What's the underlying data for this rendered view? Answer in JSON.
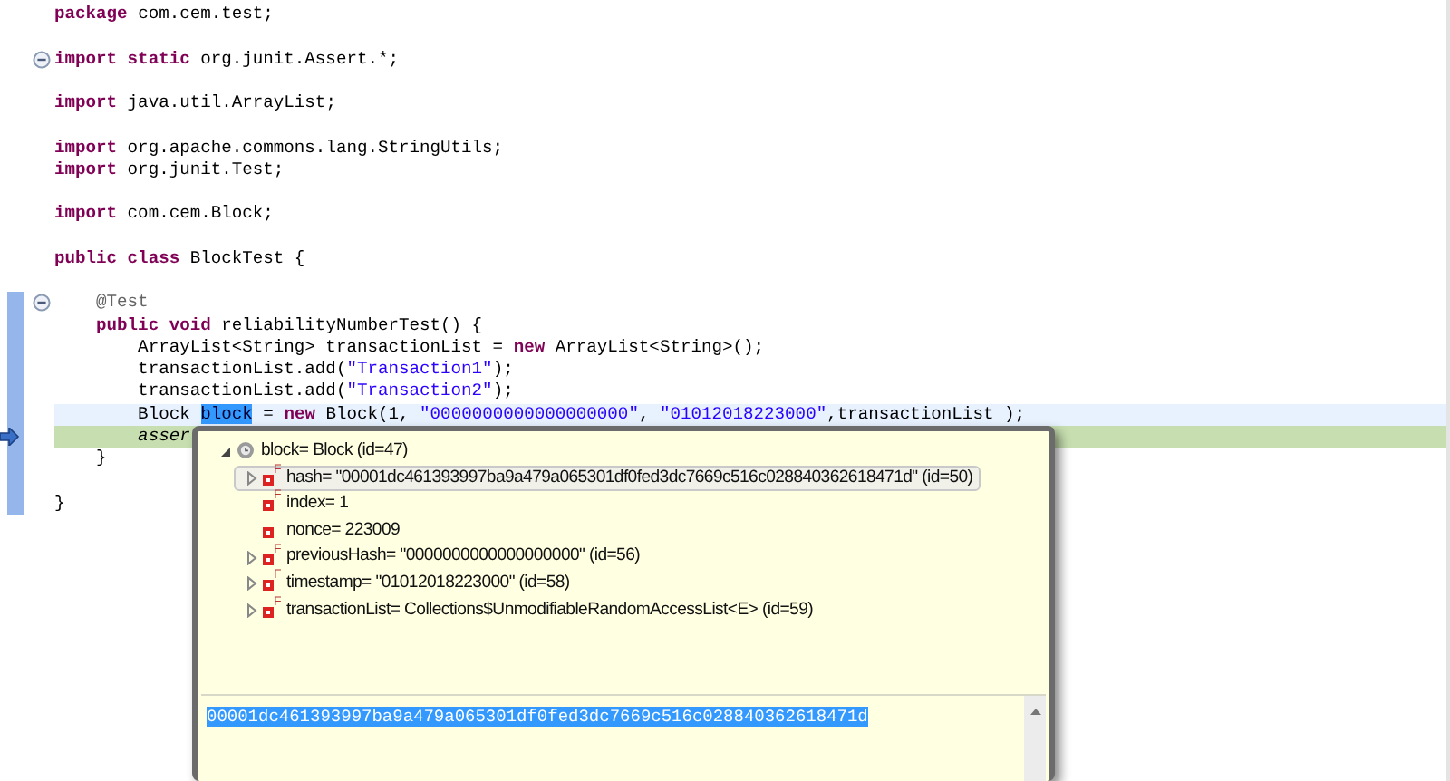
{
  "editor": {
    "lines": [
      {
        "kind": "code",
        "tokens": [
          {
            "kind": "keyword",
            "text": "package"
          },
          {
            "kind": "plain",
            "text": " com.cem.test;"
          }
        ]
      },
      {
        "kind": "blank"
      },
      {
        "kind": "code",
        "fold": true,
        "tokens": [
          {
            "kind": "keyword",
            "text": "import static"
          },
          {
            "kind": "plain",
            "text": " org.junit.Assert.*;"
          }
        ]
      },
      {
        "kind": "blank"
      },
      {
        "kind": "code",
        "tokens": [
          {
            "kind": "keyword",
            "text": "import"
          },
          {
            "kind": "plain",
            "text": " java.util.ArrayList;"
          }
        ]
      },
      {
        "kind": "blank"
      },
      {
        "kind": "code",
        "tokens": [
          {
            "kind": "keyword",
            "text": "import"
          },
          {
            "kind": "plain",
            "text": " org.apache.commons.lang.StringUtils;"
          }
        ]
      },
      {
        "kind": "code",
        "tokens": [
          {
            "kind": "keyword",
            "text": "import"
          },
          {
            "kind": "plain",
            "text": " org.junit.Test;"
          }
        ]
      },
      {
        "kind": "blank"
      },
      {
        "kind": "code",
        "tokens": [
          {
            "kind": "keyword",
            "text": "import"
          },
          {
            "kind": "plain",
            "text": " com.cem.Block;"
          }
        ]
      },
      {
        "kind": "blank"
      },
      {
        "kind": "code",
        "tokens": [
          {
            "kind": "keyword",
            "text": "public class"
          },
          {
            "kind": "plain",
            "text": " BlockTest {"
          }
        ]
      },
      {
        "kind": "blank"
      },
      {
        "kind": "code",
        "fold": true,
        "in_range": true,
        "tokens": [
          {
            "kind": "annotation",
            "text": "    @Test"
          }
        ]
      },
      {
        "kind": "code",
        "in_range": true,
        "tokens": [
          {
            "kind": "keyword",
            "text": "    public void"
          },
          {
            "kind": "plain",
            "text": " reliabilityNumberTest() {"
          }
        ]
      },
      {
        "kind": "code",
        "in_range": true,
        "tokens": [
          {
            "kind": "plain",
            "text": "        ArrayList<String> transactionList = "
          },
          {
            "kind": "keyword",
            "text": "new"
          },
          {
            "kind": "plain",
            "text": " ArrayList<String>();"
          }
        ]
      },
      {
        "kind": "code",
        "in_range": true,
        "tokens": [
          {
            "kind": "plain",
            "text": "        transactionList.add("
          },
          {
            "kind": "string",
            "text": "\"Transaction1\""
          },
          {
            "kind": "plain",
            "text": ");"
          }
        ]
      },
      {
        "kind": "code",
        "in_range": true,
        "tokens": [
          {
            "kind": "plain",
            "text": "        transactionList.add("
          },
          {
            "kind": "string",
            "text": "\"Transaction2\""
          },
          {
            "kind": "plain",
            "text": ");"
          }
        ]
      },
      {
        "kind": "code",
        "in_range": true,
        "current": true,
        "tokens": [
          {
            "kind": "plain",
            "text": "        Block "
          },
          {
            "kind": "selected",
            "text": "block"
          },
          {
            "kind": "plain",
            "text": " = "
          },
          {
            "kind": "keyword",
            "text": "new"
          },
          {
            "kind": "plain",
            "text": " Block(1, "
          },
          {
            "kind": "string",
            "text": "\"0000000000000000000\""
          },
          {
            "kind": "plain",
            "text": ", "
          },
          {
            "kind": "string",
            "text": "\"01012018223000\""
          },
          {
            "kind": "plain",
            "text": ",transactionList );"
          }
        ]
      },
      {
        "kind": "code",
        "in_range": true,
        "debug_current": true,
        "tokens": [
          {
            "kind": "static",
            "text": "        asser"
          }
        ]
      },
      {
        "kind": "code",
        "in_range": true,
        "tokens": [
          {
            "kind": "plain",
            "text": "    }"
          }
        ]
      },
      {
        "kind": "blank",
        "in_range": true
      },
      {
        "kind": "code",
        "in_range": true,
        "tokens": [
          {
            "kind": "plain",
            "text": "}"
          }
        ]
      }
    ]
  },
  "inspect_popup": {
    "tree": [
      {
        "kind": "local",
        "label": "block= Block  (id=47)",
        "expanded": true,
        "selected": false,
        "children": [
          {
            "kind": "field",
            "modifier": "F",
            "label": "hash= \"00001dc461393997ba9a479a065301df0fed3dc7669c516c028840362618471d\" (id=50)",
            "expanded": false,
            "selected": true
          },
          {
            "kind": "field",
            "modifier": "F",
            "label": "index= 1",
            "selected": false
          },
          {
            "kind": "field",
            "label": "nonce= 223009",
            "selected": false
          },
          {
            "kind": "field",
            "modifier": "F",
            "label": "previousHash= \"0000000000000000000\" (id=56)",
            "expanded": false,
            "selected": false
          },
          {
            "kind": "field",
            "modifier": "F",
            "label": "timestamp= \"01012018223000\" (id=58)",
            "expanded": false,
            "selected": false
          },
          {
            "kind": "field",
            "modifier": "F",
            "label": "transactionList= Collections$UnmodifiableRandomAccessList<E>  (id=59)",
            "expanded": false,
            "selected": false
          }
        ]
      }
    ],
    "detail": {
      "text": "00001dc461393997ba9a479a065301df0fed3dc7669c516c028840362618471d",
      "selected": true
    }
  }
}
